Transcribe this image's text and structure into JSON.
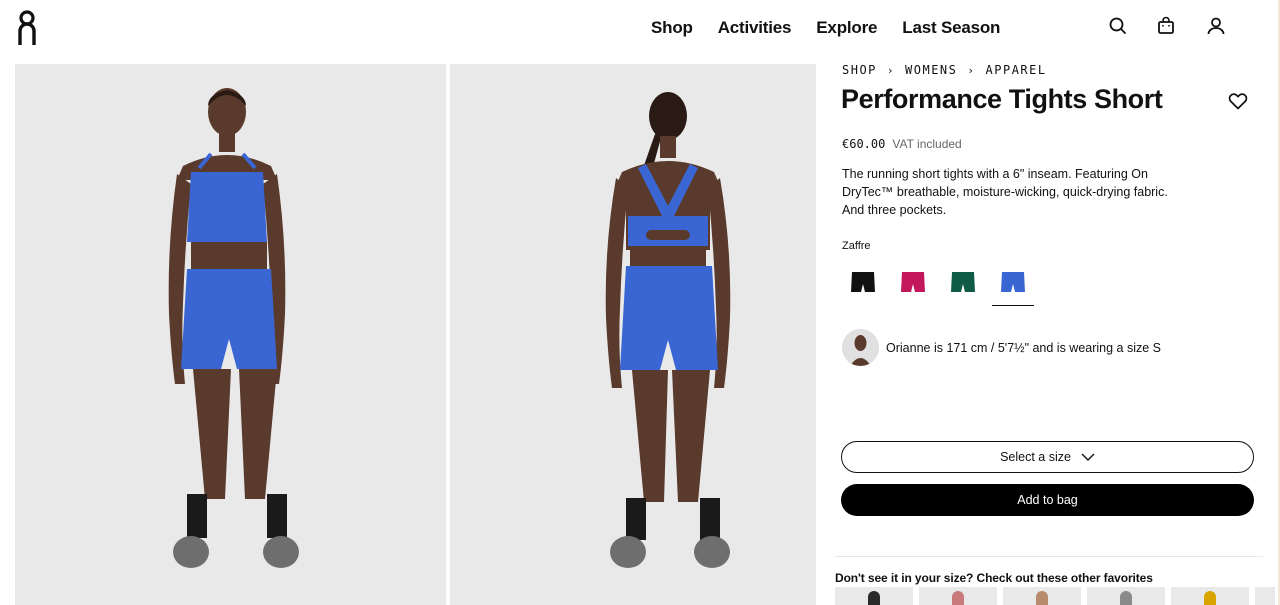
{
  "header": {
    "logo_icon": "on-logo",
    "nav": [
      "Shop",
      "Activities",
      "Explore",
      "Last Season"
    ],
    "icons": [
      "search-icon",
      "bag-icon",
      "account-icon"
    ]
  },
  "gallery": {
    "images": [
      "product-front-image",
      "product-back-image"
    ]
  },
  "product": {
    "breadcrumb": [
      "SHOP",
      "WOMENS",
      "APPAREL"
    ],
    "title": "Performance Tights Short",
    "price": "€60.00",
    "vat": "VAT included",
    "description": "The running short tights with a 6\" inseam. Featuring On DryTec™ breathable, moisture-wicking, quick-drying fabric. And three pockets.",
    "color_name": "Zaffre",
    "swatches": [
      {
        "color": "#111111",
        "selected": false
      },
      {
        "color": "#c2185b",
        "selected": false
      },
      {
        "color": "#0f5b45",
        "selected": false
      },
      {
        "color": "#3a66d4",
        "selected": true
      }
    ],
    "model_info": "Orianne is 171 cm / 5'7½\" and is wearing a size S",
    "size_select_label": "Select a size",
    "add_to_bag_label": "Add to bag"
  },
  "favorites": {
    "title": "Don't see it in your size? Check out these other favorites",
    "thumb_colors": [
      "#2a2a2a",
      "#c97b7b",
      "#b98b6e",
      "#8a8a8a",
      "#d9a300",
      "#444444"
    ]
  },
  "colors": {
    "accent_blue": "#3a66d4",
    "image_bg": "#e9e9ea",
    "button_black": "#000000"
  }
}
